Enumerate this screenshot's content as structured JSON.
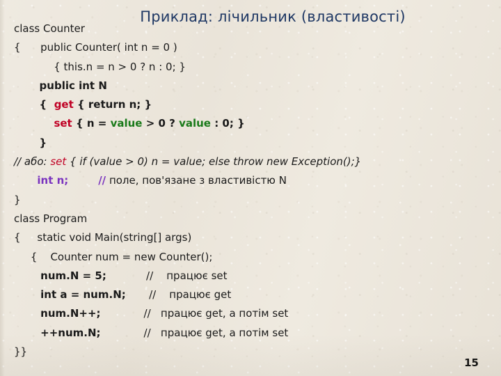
{
  "slide": {
    "title": "Приклад: лічильник (властивості)",
    "title_color": "#1f3864",
    "background_color": "#ece7dd",
    "page_number": "15"
  },
  "palette": {
    "keyword_red": "#c00024",
    "value_green": "#1a7a1a",
    "field_purple": "#7a34bf",
    "default_dark": "#1a1a1a"
  },
  "code_lines": [
    {
      "id": "line-class-counter",
      "indent": 0,
      "tokens": [
        {
          "text": "class Counter",
          "style": "dark"
        }
      ]
    },
    {
      "id": "line-open-brace-ctor",
      "indent": 0,
      "tokens": [
        {
          "text": "{      public Counter( int n = 0 )",
          "style": "dark"
        }
      ]
    },
    {
      "id": "line-ctor-body",
      "indent": 0,
      "tokens": [
        {
          "text": "            { this.n = n > 0 ? n : 0; }",
          "style": "dark"
        }
      ]
    },
    {
      "id": "line-public-int-n",
      "indent": 0,
      "tokens": [
        {
          "text": "       public int N",
          "style": "dark-bold"
        }
      ]
    },
    {
      "id": "line-get",
      "indent": 0,
      "tokens": [
        {
          "text": "       {  ",
          "style": "dark-bold"
        },
        {
          "text": "get",
          "style": "red-bold"
        },
        {
          "text": " { return n; }",
          "style": "dark-bold"
        }
      ]
    },
    {
      "id": "line-set",
      "indent": 0,
      "tokens": [
        {
          "text": "           ",
          "style": "dark-bold"
        },
        {
          "text": "set",
          "style": "red-bold"
        },
        {
          "text": " { n = ",
          "style": "dark-bold"
        },
        {
          "text": "value",
          "style": "green-bold"
        },
        {
          "text": " > 0 ? ",
          "style": "dark-bold"
        },
        {
          "text": "value",
          "style": "green-bold"
        },
        {
          "text": " : 0; }",
          "style": "dark-bold"
        }
      ]
    },
    {
      "id": "line-close-property",
      "indent": 0,
      "tokens": [
        {
          "text": "       }",
          "style": "dark-bold"
        }
      ]
    },
    {
      "id": "line-alt-set-comment",
      "indent": 0,
      "tokens": [
        {
          "text": "// або: ",
          "style": "dark-italic"
        },
        {
          "text": "set",
          "style": "red-italic"
        },
        {
          "text": " { if (value > 0) n = value; else throw new Exception();}",
          "style": "dark-italic"
        }
      ]
    },
    {
      "id": "line-field-n",
      "indent": 0,
      "tokens": [
        {
          "text": "       ",
          "style": "dark"
        },
        {
          "text": "int n;",
          "style": "purple-bold"
        },
        {
          "text": "         ",
          "style": "dark"
        },
        {
          "text": "//",
          "style": "purple-bold"
        },
        {
          "text": " поле, пов'язане з властивістю N",
          "style": "dark"
        }
      ]
    },
    {
      "id": "line-close-class-counter",
      "indent": 0,
      "tokens": [
        {
          "text": "}",
          "style": "dark"
        }
      ]
    },
    {
      "id": "line-class-program",
      "indent": 0,
      "tokens": [
        {
          "text": "class Program",
          "style": "dark"
        }
      ]
    },
    {
      "id": "line-main",
      "indent": 0,
      "tokens": [
        {
          "text": "{     static void Main(string[] args)",
          "style": "dark"
        }
      ]
    },
    {
      "id": "line-new-counter",
      "indent": 0,
      "tokens": [
        {
          "text": "     {    Counter num = new Counter();",
          "style": "dark"
        }
      ]
    },
    {
      "id": "line-set-five",
      "indent": 0,
      "tokens": [
        {
          "text": "        ",
          "style": "dark"
        },
        {
          "text": "num.N = 5;",
          "style": "dark-bold"
        },
        {
          "text": "            //    працює set",
          "style": "dark"
        }
      ]
    },
    {
      "id": "line-get-a",
      "indent": 0,
      "tokens": [
        {
          "text": "        ",
          "style": "dark"
        },
        {
          "text": "int a = num.N;",
          "style": "dark-bold"
        },
        {
          "text": "       //    працює get",
          "style": "dark"
        }
      ]
    },
    {
      "id": "line-postincrement",
      "indent": 0,
      "tokens": [
        {
          "text": "        ",
          "style": "dark"
        },
        {
          "text": "num.N++;",
          "style": "dark-bold"
        },
        {
          "text": "             //   працює get, а потім set",
          "style": "dark"
        }
      ]
    },
    {
      "id": "line-preincrement",
      "indent": 0,
      "tokens": [
        {
          "text": "        ",
          "style": "dark"
        },
        {
          "text": "++num.N;",
          "style": "dark-bold"
        },
        {
          "text": "             //   працює get, а потім set",
          "style": "dark"
        }
      ]
    },
    {
      "id": "line-close-all",
      "indent": 0,
      "tokens": [
        {
          "text": "}}",
          "style": "dark"
        }
      ]
    }
  ]
}
